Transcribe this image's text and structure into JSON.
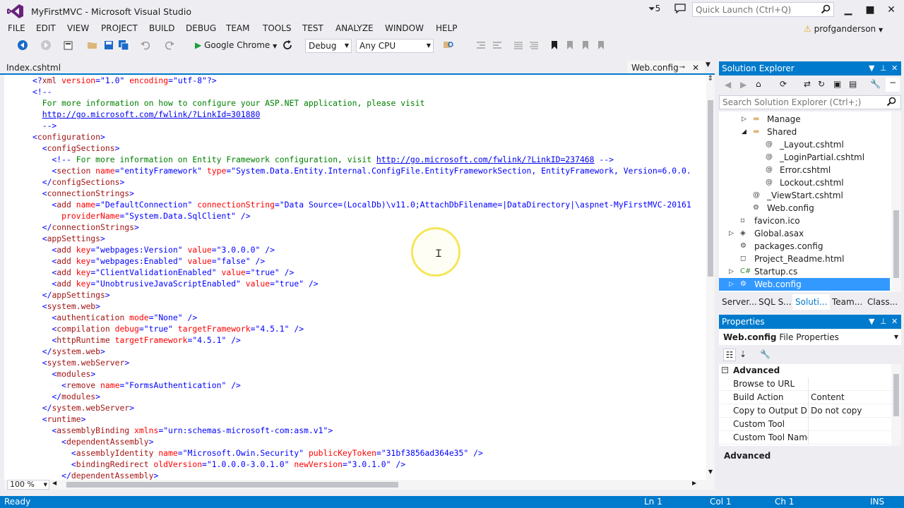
{
  "window": {
    "title": "MyFirstMVC - Microsoft Visual Studio",
    "notification_count": "5",
    "quick_launch_placeholder": "Quick Launch (Ctrl+Q)",
    "user": "profganderson",
    "accent_color": "#007acc"
  },
  "menu": [
    "FILE",
    "EDIT",
    "VIEW",
    "PROJECT",
    "BUILD",
    "DEBUG",
    "TEAM",
    "TOOLS",
    "TEST",
    "ANALYZE",
    "WINDOW",
    "HELP"
  ],
  "toolbar": {
    "start_label": "Google Chrome",
    "configuration": "Debug",
    "platform": "Any CPU"
  },
  "editor": {
    "tabs": [
      {
        "label": "Index.cshtml",
        "active": false
      },
      {
        "label": "Web.config",
        "active": true
      }
    ],
    "zoom": "100 %",
    "lines": [
      "<?xml version=\"1.0\" encoding=\"utf-8\"?>",
      "<!--",
      "  For more information on how to configure your ASP.NET application, please visit",
      "  http://go.microsoft.com/fwlink/?LinkId=301880",
      "  -->",
      "<configuration>",
      "  <configSections>",
      "    <!-- For more information on Entity Framework configuration, visit http://go.microsoft.com/fwlink/?LinkID=237468 -->",
      "    <section name=\"entityFramework\" type=\"System.Data.Entity.Internal.ConfigFile.EntityFrameworkSection, EntityFramework, Version=6.0.0.",
      "  </configSections>",
      "  <connectionStrings>",
      "    <add name=\"DefaultConnection\" connectionString=\"Data Source=(LocalDb)\\v11.0;AttachDbFilename=|DataDirectory|\\aspnet-MyFirstMVC-20161",
      "      providerName=\"System.Data.SqlClient\" />",
      "  </connectionStrings>",
      "  <appSettings>",
      "    <add key=\"webpages:Version\" value=\"3.0.0.0\" />",
      "    <add key=\"webpages:Enabled\" value=\"false\" />",
      "    <add key=\"ClientValidationEnabled\" value=\"true\" />",
      "    <add key=\"UnobtrusiveJavaScriptEnabled\" value=\"true\" />",
      "  </appSettings>",
      "  <system.web>",
      "    <authentication mode=\"None\" />",
      "    <compilation debug=\"true\" targetFramework=\"4.5.1\" />",
      "    <httpRuntime targetFramework=\"4.5.1\" />",
      "  </system.web>",
      "  <system.webServer>",
      "    <modules>",
      "      <remove name=\"FormsAuthentication\" />",
      "    </modules>",
      "  </system.webServer>",
      "  <runtime>",
      "    <assemblyBinding xmlns=\"urn:schemas-microsoft-com:asm.v1\">",
      "      <dependentAssembly>",
      "        <assemblyIdentity name=\"Microsoft.Owin.Security\" publicKeyToken=\"31bf3856ad364e35\" />",
      "        <bindingRedirect oldVersion=\"1.0.0.0-3.0.1.0\" newVersion=\"3.0.1.0\" />",
      "      </dependentAssembly>"
    ]
  },
  "solution_explorer": {
    "title": "Solution Explorer",
    "search_placeholder": "Search Solution Explorer (Ctrl+;)",
    "items": [
      {
        "label": "Manage",
        "icon": "folder-icon",
        "expander": "collapsed"
      },
      {
        "label": "Shared",
        "icon": "folder-open-icon",
        "expander": "expanded"
      },
      {
        "label": "_Layout.cshtml",
        "icon": "razor-file-icon",
        "expander": "none"
      },
      {
        "label": "_LoginPartial.cshtml",
        "icon": "razor-file-icon",
        "expander": "none"
      },
      {
        "label": "Error.cshtml",
        "icon": "razor-file-icon",
        "expander": "none"
      },
      {
        "label": "Lockout.cshtml",
        "icon": "razor-file-icon",
        "expander": "none"
      },
      {
        "label": "_ViewStart.cshtml",
        "icon": "razor-file-icon",
        "expander": "none"
      },
      {
        "label": "Web.config",
        "icon": "config-file-icon",
        "expander": "none"
      },
      {
        "label": "favicon.ico",
        "icon": "image-file-icon",
        "expander": "none"
      },
      {
        "label": "Global.asax",
        "icon": "asax-file-icon",
        "expander": "collapsed"
      },
      {
        "label": "packages.config",
        "icon": "config-file-icon",
        "expander": "none"
      },
      {
        "label": "Project_Readme.html",
        "icon": "html-file-icon",
        "expander": "none"
      },
      {
        "label": "Startup.cs",
        "icon": "csharp-file-icon",
        "expander": "collapsed"
      },
      {
        "label": "Web.config",
        "icon": "config-file-icon",
        "expander": "collapsed",
        "selected": true
      }
    ],
    "bottom_tabs": [
      "Server...",
      "SQL S...",
      "Soluti...",
      "Team...",
      "Class..."
    ]
  },
  "properties": {
    "title": "Properties",
    "object_name": "Web.config",
    "object_type": "File Properties",
    "category": "Advanced",
    "rows": [
      {
        "name": "Browse to URL",
        "value": ""
      },
      {
        "name": "Build Action",
        "value": "Content"
      },
      {
        "name": "Copy to Output Directory",
        "value": "Do not copy"
      },
      {
        "name": "Custom Tool",
        "value": ""
      },
      {
        "name": "Custom Tool Name",
        "value": ""
      }
    ],
    "description_title": "Advanced"
  },
  "status": {
    "message": "Ready",
    "line": "Ln 1",
    "col": "Col 1",
    "ch": "Ch 1",
    "mode": "INS"
  }
}
